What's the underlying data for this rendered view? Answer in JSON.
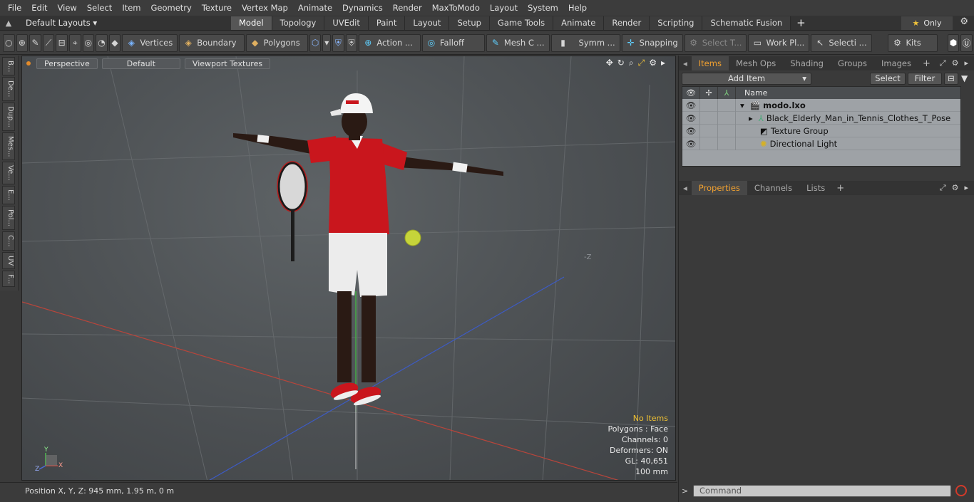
{
  "menu": [
    "File",
    "Edit",
    "View",
    "Select",
    "Item",
    "Geometry",
    "Texture",
    "Vertex Map",
    "Animate",
    "Dynamics",
    "Render",
    "MaxToModo",
    "Layout",
    "System",
    "Help"
  ],
  "layout_selector": "Default Layouts ▾",
  "tabs": [
    {
      "label": "Model",
      "active": true
    },
    {
      "label": "Topology"
    },
    {
      "label": "UVEdit"
    },
    {
      "label": "Paint"
    },
    {
      "label": "Layout"
    },
    {
      "label": "Setup"
    },
    {
      "label": "Game Tools"
    },
    {
      "label": "Animate"
    },
    {
      "label": "Render"
    },
    {
      "label": "Scripting"
    },
    {
      "label": "Schematic Fusion"
    }
  ],
  "only_label": "Only",
  "toolbar": {
    "vertices": "Vertices",
    "boundary": "Boundary",
    "polygons": "Polygons",
    "action": "Action ...",
    "falloff": "Falloff",
    "mesh": "Mesh C ...",
    "symm": "Symm ...",
    "snapping": "Snapping",
    "select_t": "Select T...",
    "work_pl": "Work Pl...",
    "selecti": "Selecti ...",
    "kits": "Kits"
  },
  "left_tabs": [
    "B...",
    "De...",
    "Dup...",
    "Mes...",
    "Ve...",
    "E...",
    "Pol...",
    "C...",
    "UV",
    "F..."
  ],
  "viewport": {
    "view": "Perspective",
    "shading": "Default",
    "textures": "Viewport Textures",
    "axis_neg_z": "-Z",
    "hud": {
      "no_items": "No Items",
      "polygons": "Polygons : Face",
      "channels": "Channels: 0",
      "deformers": "Deformers: ON",
      "gl": "GL: 40,651",
      "scale": "100 mm"
    },
    "gizmo": {
      "y": "Y",
      "z": "Z",
      "x": "X"
    }
  },
  "status": "Position X, Y, Z:   945 mm, 1.95 m, 0 m",
  "items_panel": {
    "tabs": [
      {
        "label": "Items",
        "active": true
      },
      {
        "label": "Mesh Ops"
      },
      {
        "label": "Shading"
      },
      {
        "label": "Groups"
      },
      {
        "label": "Images"
      }
    ],
    "add_item": "Add Item",
    "select": "Select",
    "filter": "Filter",
    "column_name": "Name",
    "rows": [
      {
        "name": "modo.lxo",
        "bold": true
      },
      {
        "name": "Black_Elderly_Man_in_Tennis_Clothes_T_Pose"
      },
      {
        "name": "Texture Group"
      },
      {
        "name": "Directional Light"
      }
    ]
  },
  "props_panel": {
    "tabs": [
      {
        "label": "Properties",
        "active": true
      },
      {
        "label": "Channels"
      },
      {
        "label": "Lists"
      }
    ]
  },
  "command_placeholder": "Command",
  "colors": {
    "accent": "#f0a030",
    "active_tab": "#565656",
    "shirt": "#c9161d",
    "ball": "#c6d43a"
  }
}
